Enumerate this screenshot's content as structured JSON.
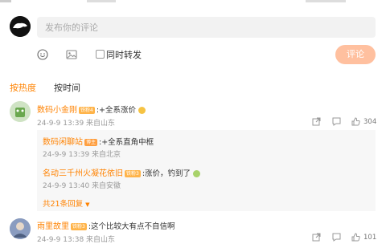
{
  "composer": {
    "placeholder": "发布你的评论",
    "repost_label": "同时转发",
    "submit_label": "评论"
  },
  "sort": {
    "hot_label": "按热度",
    "time_label": "按时间"
  },
  "comments": [
    {
      "user": "数码小金刚",
      "badge": "铁粉4",
      "text": ":+全系涨价",
      "meta": "24-9-9 13:39 来自山东",
      "likes": "304",
      "replies": [
        {
          "user": "数码闲聊站",
          "badge": "博主",
          "text": ":+全系直角中框",
          "meta": "24-9-9 13:39 来自北京"
        },
        {
          "user": "名动三千州火凝花依旧",
          "badge": "铁粉3",
          "text": ":涨价，钓到了",
          "meta": "24-9-9 13:40 来自安徽"
        }
      ],
      "more_replies": "共21条回复"
    },
    {
      "user": "雨里故里",
      "badge": "铁粉3",
      "text": ":这个比较大有点不自信啊",
      "meta": "24-9-9 13:38 来自山东",
      "likes": "101"
    }
  ],
  "colors": {
    "accent": "#ff8200",
    "button_disabled": "#ffc09f",
    "input_bg": "#f2f2f2",
    "reply_bg": "#f7f7f7"
  },
  "icons": [
    "user-avatar-icon",
    "emoji-icon",
    "image-icon",
    "repost-icon",
    "comment-icon",
    "like-icon",
    "chevron-down-icon"
  ]
}
